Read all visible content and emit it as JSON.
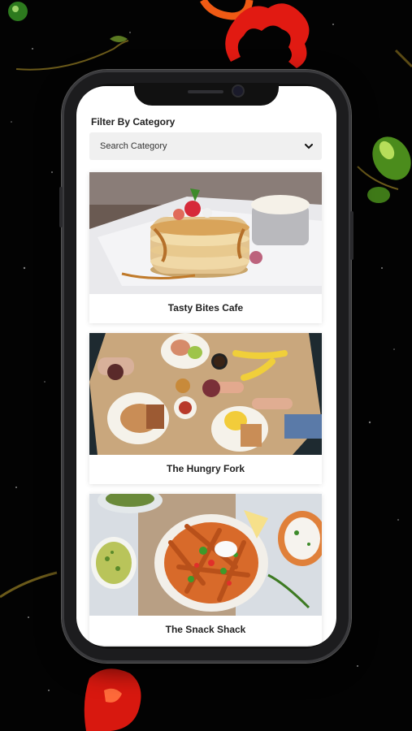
{
  "filter": {
    "label": "Filter By Category",
    "search_placeholder": "Search Category"
  },
  "cards": [
    {
      "title": "Tasty Bites Cafe",
      "image": "pancake-stack-photo"
    },
    {
      "title": "The Hungry Fork",
      "image": "breakfast-table-photo"
    },
    {
      "title": "The Snack Shack",
      "image": "sweet-potato-fries-photo"
    }
  ],
  "colors": {
    "background": "#030303",
    "screen": "#ffffff",
    "search_bg": "#f0f0f0"
  }
}
